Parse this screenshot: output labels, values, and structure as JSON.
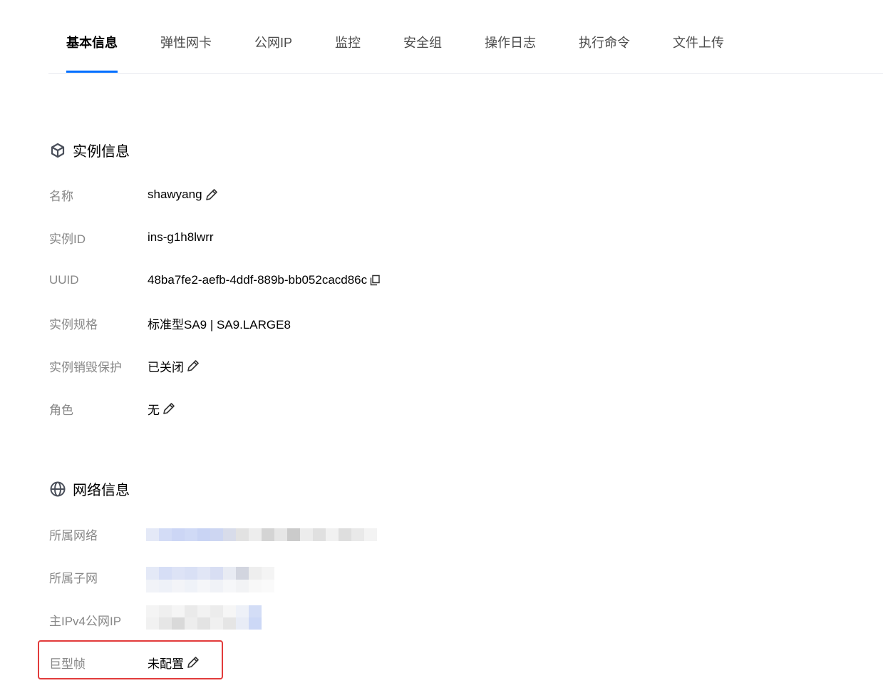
{
  "tabs": [
    {
      "label": "基本信息",
      "active": true
    },
    {
      "label": "弹性网卡"
    },
    {
      "label": "公网IP"
    },
    {
      "label": "监控"
    },
    {
      "label": "安全组"
    },
    {
      "label": "操作日志"
    },
    {
      "label": "执行命令"
    },
    {
      "label": "文件上传"
    }
  ],
  "instance": {
    "title": "实例信息",
    "rows": [
      {
        "label": "名称",
        "value": "shawyang",
        "action": "edit-icon"
      },
      {
        "label": "实例ID",
        "value": "ins-g1h8lwrr"
      },
      {
        "label": "UUID",
        "value": "48ba7fe2-aefb-4ddf-889b-bb052cacd86c",
        "action": "copy-icon"
      },
      {
        "label": "实例规格",
        "value": "标准型SA9 | SA9.LARGE8"
      },
      {
        "label": "实例销毁保护",
        "value": "已关闭",
        "action": "edit-icon"
      },
      {
        "label": "角色",
        "value": "无",
        "action": "edit-icon"
      }
    ]
  },
  "network": {
    "title": "网络信息",
    "rows": [
      {
        "label": "所属网络",
        "value": ""
      },
      {
        "label": "所属子网",
        "value": ""
      },
      {
        "label": "主IPv4公网IP",
        "value": ""
      },
      {
        "label": "巨型帧",
        "value": "未配置",
        "action": "edit-icon"
      }
    ]
  },
  "colors": {
    "accent": "#006eff",
    "highlight": "#e23b3b",
    "label": "#888888"
  }
}
